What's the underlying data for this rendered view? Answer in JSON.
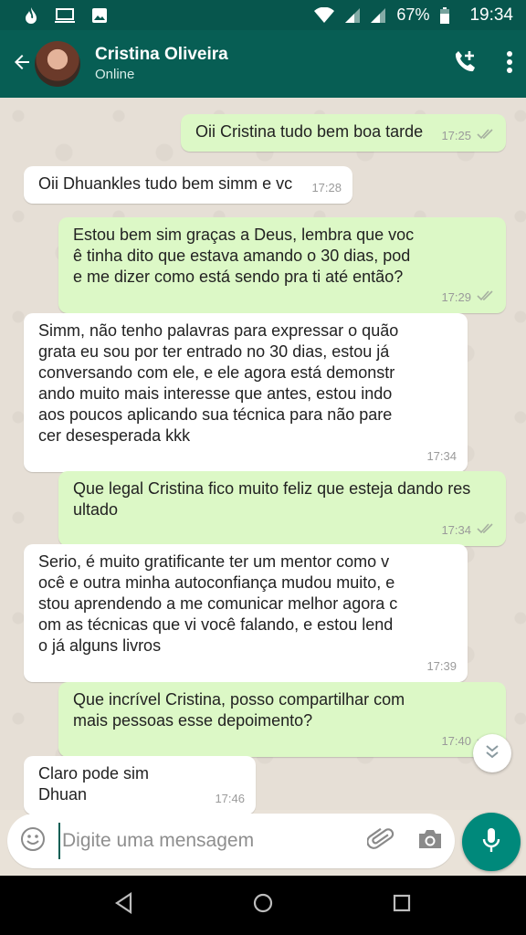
{
  "status_bar": {
    "battery": "67%",
    "time": "19:34",
    "icons": [
      "flame-icon",
      "monitor-icon",
      "image-icon",
      "wifi-icon",
      "signal-icon",
      "signal-icon",
      "battery-icon"
    ]
  },
  "header": {
    "contact_name": "Cristina Oliveira",
    "contact_status": "Online",
    "icons": [
      "back-arrow-icon",
      "add-call-icon",
      "more-vert-icon"
    ]
  },
  "messages": [
    {
      "dir": "out",
      "text": "Oii Cristina tudo bem boa tarde",
      "time": "17:25",
      "ticks": true
    },
    {
      "dir": "in",
      "text": "Oii Dhuankles tudo bem simm e vc",
      "time": "17:28"
    },
    {
      "dir": "out",
      "text": "Estou bem sim graças a Deus, lembra que voc\nê tinha dito que estava amando o 30 dias, pod\ne me dizer como está sendo pra ti até então?",
      "time": "17:29",
      "ticks": true
    },
    {
      "dir": "in",
      "text": "Simm, não tenho palavras para expressar o quão\ngrata eu sou por ter entrado no 30 dias, estou já\nconversando com ele, e ele agora está demonstr\nando muito mais interesse que antes, estou indo\naos poucos aplicando sua técnica para não pare\ncer desesperada kkk",
      "time": "17:34"
    },
    {
      "dir": "out",
      "text": "Que legal Cristina fico muito feliz que esteja dando res\nultado",
      "time": "17:34",
      "ticks": true
    },
    {
      "dir": "in",
      "text": "Serio, é muito gratificante ter um mentor como v\nocê e outra minha autoconfiança mudou muito, e\nstou aprendendo a me comunicar melhor agora c\nom as técnicas que vi você falando, e estou lend\no já alguns livros",
      "time": "17:39"
    },
    {
      "dir": "out",
      "text": "Que incrível Cristina, posso compartilhar com\nmais pessoas esse depoimento?",
      "time": "17:40",
      "ticks": true
    },
    {
      "dir": "in",
      "text": "Claro pode sim Dhuan",
      "time": "17:46"
    }
  ],
  "composer": {
    "placeholder": "Digite uma mensagem",
    "icons": [
      "emoji-icon",
      "attach-icon",
      "camera-icon",
      "mic-icon"
    ]
  },
  "colors": {
    "header": "#075e54",
    "outgoing_bubble": "#dcf8c6",
    "incoming_bubble": "#ffffff",
    "accent": "#00897b"
  }
}
